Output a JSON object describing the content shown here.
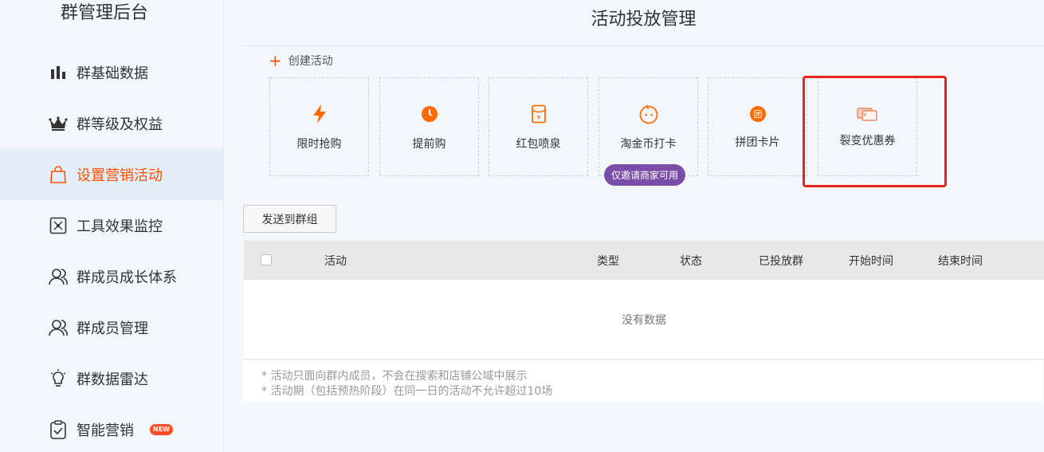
{
  "sidebar": {
    "title": "群管理后台",
    "items": [
      {
        "label": "群基础数据",
        "icon": "bar-chart-icon"
      },
      {
        "label": "群等级及权益",
        "icon": "crown-icon"
      },
      {
        "label": "设置营销活动",
        "icon": "shopping-bag-icon",
        "active": true
      },
      {
        "label": "工具效果监控",
        "icon": "monitor-icon"
      },
      {
        "label": "群成员成长体系",
        "icon": "user-icon"
      },
      {
        "label": "群成员管理",
        "icon": "user-icon"
      },
      {
        "label": "群数据雷达",
        "icon": "lightbulb-icon"
      },
      {
        "label": "智能营销",
        "icon": "clipboard-check-icon",
        "badge": "NEW"
      }
    ]
  },
  "main": {
    "title": "活动投放管理",
    "create_label": "创建活动",
    "cards": [
      {
        "label": "限时抢购",
        "icon": "lightning-icon"
      },
      {
        "label": "提前购",
        "icon": "clock-icon"
      },
      {
        "label": "红包喷泉",
        "icon": "red-envelope-icon"
      },
      {
        "label": "淘金币打卡",
        "icon": "coin-face-icon",
        "badge": "仅邀请商家可用"
      },
      {
        "label": "拼团卡片",
        "icon": "group-buy-icon"
      },
      {
        "label": "裂变优惠券",
        "icon": "coupon-icon"
      }
    ],
    "send_button": "发送到群组",
    "table": {
      "headers": [
        "活动",
        "类型",
        "状态",
        "已投放群",
        "开始时间",
        "结束时间"
      ],
      "empty_text": "没有数据"
    },
    "notes": [
      "* 活动只面向群内成员，不会在搜索和店铺公域中展示",
      "* 活动期（包括预热阶段）在同一日的活动不允许超过10场"
    ]
  },
  "colors": {
    "accent": "#ff5000",
    "active_bg": "#e3eef9",
    "badge_purple": "#7a4ea8",
    "highlight_red": "#e8231a"
  }
}
